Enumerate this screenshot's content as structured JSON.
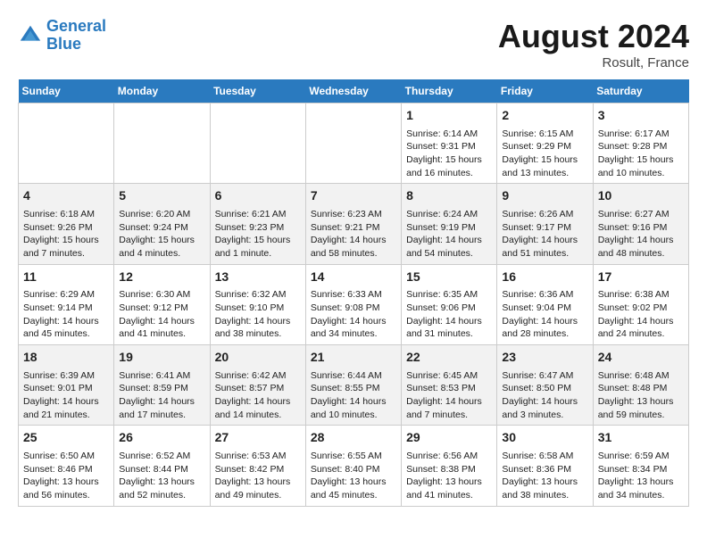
{
  "header": {
    "logo_line1": "General",
    "logo_line2": "Blue",
    "month_year": "August 2024",
    "location": "Rosult, France"
  },
  "weekdays": [
    "Sunday",
    "Monday",
    "Tuesday",
    "Wednesday",
    "Thursday",
    "Friday",
    "Saturday"
  ],
  "weeks": [
    [
      {
        "day": "",
        "details": ""
      },
      {
        "day": "",
        "details": ""
      },
      {
        "day": "",
        "details": ""
      },
      {
        "day": "",
        "details": ""
      },
      {
        "day": "1",
        "details": "Sunrise: 6:14 AM\nSunset: 9:31 PM\nDaylight: 15 hours and 16 minutes."
      },
      {
        "day": "2",
        "details": "Sunrise: 6:15 AM\nSunset: 9:29 PM\nDaylight: 15 hours and 13 minutes."
      },
      {
        "day": "3",
        "details": "Sunrise: 6:17 AM\nSunset: 9:28 PM\nDaylight: 15 hours and 10 minutes."
      }
    ],
    [
      {
        "day": "4",
        "details": "Sunrise: 6:18 AM\nSunset: 9:26 PM\nDaylight: 15 hours and 7 minutes."
      },
      {
        "day": "5",
        "details": "Sunrise: 6:20 AM\nSunset: 9:24 PM\nDaylight: 15 hours and 4 minutes."
      },
      {
        "day": "6",
        "details": "Sunrise: 6:21 AM\nSunset: 9:23 PM\nDaylight: 15 hours and 1 minute."
      },
      {
        "day": "7",
        "details": "Sunrise: 6:23 AM\nSunset: 9:21 PM\nDaylight: 14 hours and 58 minutes."
      },
      {
        "day": "8",
        "details": "Sunrise: 6:24 AM\nSunset: 9:19 PM\nDaylight: 14 hours and 54 minutes."
      },
      {
        "day": "9",
        "details": "Sunrise: 6:26 AM\nSunset: 9:17 PM\nDaylight: 14 hours and 51 minutes."
      },
      {
        "day": "10",
        "details": "Sunrise: 6:27 AM\nSunset: 9:16 PM\nDaylight: 14 hours and 48 minutes."
      }
    ],
    [
      {
        "day": "11",
        "details": "Sunrise: 6:29 AM\nSunset: 9:14 PM\nDaylight: 14 hours and 45 minutes."
      },
      {
        "day": "12",
        "details": "Sunrise: 6:30 AM\nSunset: 9:12 PM\nDaylight: 14 hours and 41 minutes."
      },
      {
        "day": "13",
        "details": "Sunrise: 6:32 AM\nSunset: 9:10 PM\nDaylight: 14 hours and 38 minutes."
      },
      {
        "day": "14",
        "details": "Sunrise: 6:33 AM\nSunset: 9:08 PM\nDaylight: 14 hours and 34 minutes."
      },
      {
        "day": "15",
        "details": "Sunrise: 6:35 AM\nSunset: 9:06 PM\nDaylight: 14 hours and 31 minutes."
      },
      {
        "day": "16",
        "details": "Sunrise: 6:36 AM\nSunset: 9:04 PM\nDaylight: 14 hours and 28 minutes."
      },
      {
        "day": "17",
        "details": "Sunrise: 6:38 AM\nSunset: 9:02 PM\nDaylight: 14 hours and 24 minutes."
      }
    ],
    [
      {
        "day": "18",
        "details": "Sunrise: 6:39 AM\nSunset: 9:01 PM\nDaylight: 14 hours and 21 minutes."
      },
      {
        "day": "19",
        "details": "Sunrise: 6:41 AM\nSunset: 8:59 PM\nDaylight: 14 hours and 17 minutes."
      },
      {
        "day": "20",
        "details": "Sunrise: 6:42 AM\nSunset: 8:57 PM\nDaylight: 14 hours and 14 minutes."
      },
      {
        "day": "21",
        "details": "Sunrise: 6:44 AM\nSunset: 8:55 PM\nDaylight: 14 hours and 10 minutes."
      },
      {
        "day": "22",
        "details": "Sunrise: 6:45 AM\nSunset: 8:53 PM\nDaylight: 14 hours and 7 minutes."
      },
      {
        "day": "23",
        "details": "Sunrise: 6:47 AM\nSunset: 8:50 PM\nDaylight: 14 hours and 3 minutes."
      },
      {
        "day": "24",
        "details": "Sunrise: 6:48 AM\nSunset: 8:48 PM\nDaylight: 13 hours and 59 minutes."
      }
    ],
    [
      {
        "day": "25",
        "details": "Sunrise: 6:50 AM\nSunset: 8:46 PM\nDaylight: 13 hours and 56 minutes."
      },
      {
        "day": "26",
        "details": "Sunrise: 6:52 AM\nSunset: 8:44 PM\nDaylight: 13 hours and 52 minutes."
      },
      {
        "day": "27",
        "details": "Sunrise: 6:53 AM\nSunset: 8:42 PM\nDaylight: 13 hours and 49 minutes."
      },
      {
        "day": "28",
        "details": "Sunrise: 6:55 AM\nSunset: 8:40 PM\nDaylight: 13 hours and 45 minutes."
      },
      {
        "day": "29",
        "details": "Sunrise: 6:56 AM\nSunset: 8:38 PM\nDaylight: 13 hours and 41 minutes."
      },
      {
        "day": "30",
        "details": "Sunrise: 6:58 AM\nSunset: 8:36 PM\nDaylight: 13 hours and 38 minutes."
      },
      {
        "day": "31",
        "details": "Sunrise: 6:59 AM\nSunset: 8:34 PM\nDaylight: 13 hours and 34 minutes."
      }
    ]
  ]
}
